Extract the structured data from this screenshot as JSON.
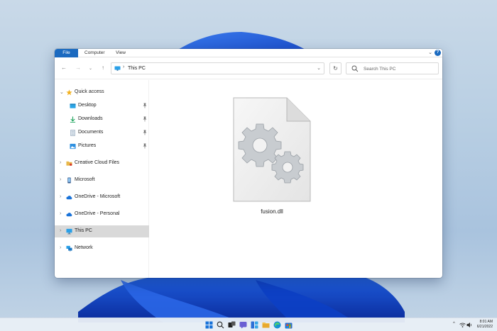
{
  "ribbon": {
    "tabs": [
      {
        "label": "File"
      },
      {
        "label": "Computer"
      },
      {
        "label": "View"
      }
    ],
    "collapse_icon": "chevron-down-icon",
    "help_label": "?"
  },
  "navigation": {
    "back_icon": "arrow-left-icon",
    "forward_icon": "arrow-right-icon",
    "recent_icon": "chevron-down-icon",
    "up_icon": "arrow-up-icon",
    "address": {
      "icon": "monitor-icon",
      "separator": "›",
      "path": "This PC"
    },
    "refresh_icon": "refresh-icon",
    "search": {
      "placeholder": "Search This PC",
      "value": ""
    }
  },
  "sidebar": {
    "items": [
      {
        "label": "Quick access",
        "icon": "star-icon"
      },
      {
        "label": "Desktop",
        "icon": "desktop-folder-icon",
        "pinned": true
      },
      {
        "label": "Downloads",
        "icon": "download-icon",
        "pinned": true
      },
      {
        "label": "Documents",
        "icon": "document-icon",
        "pinned": true
      },
      {
        "label": "Pictures",
        "icon": "pictures-icon",
        "pinned": true
      },
      {
        "label": "Creative Cloud Files",
        "icon": "folder-icon"
      },
      {
        "label": "Microsoft",
        "icon": "phone-icon"
      },
      {
        "label": "OneDrive - Microsoft",
        "icon": "cloud-icon"
      },
      {
        "label": "OneDrive - Personal",
        "icon": "cloud-icon"
      },
      {
        "label": "This PC",
        "icon": "monitor-icon",
        "selected": true
      },
      {
        "label": "Network",
        "icon": "network-icon"
      }
    ]
  },
  "content": {
    "files": [
      {
        "name": "fusion.dll",
        "icon": "dll-file-gears-icon"
      }
    ]
  },
  "taskbar": {
    "apps": [
      "windows-start-icon",
      "search-icon",
      "task-view-icon",
      "chat-icon",
      "widgets-icon",
      "file-explorer-icon",
      "edge-icon",
      "store-icon"
    ],
    "tray": {
      "chevron": "^",
      "time": "8:01 AM",
      "date": "6/21/2022"
    }
  },
  "colors": {
    "accent": "#1b6ac0",
    "selection": "#d9d9d9",
    "folder": "#e8b84a",
    "onedrive": "#1a73d9"
  }
}
